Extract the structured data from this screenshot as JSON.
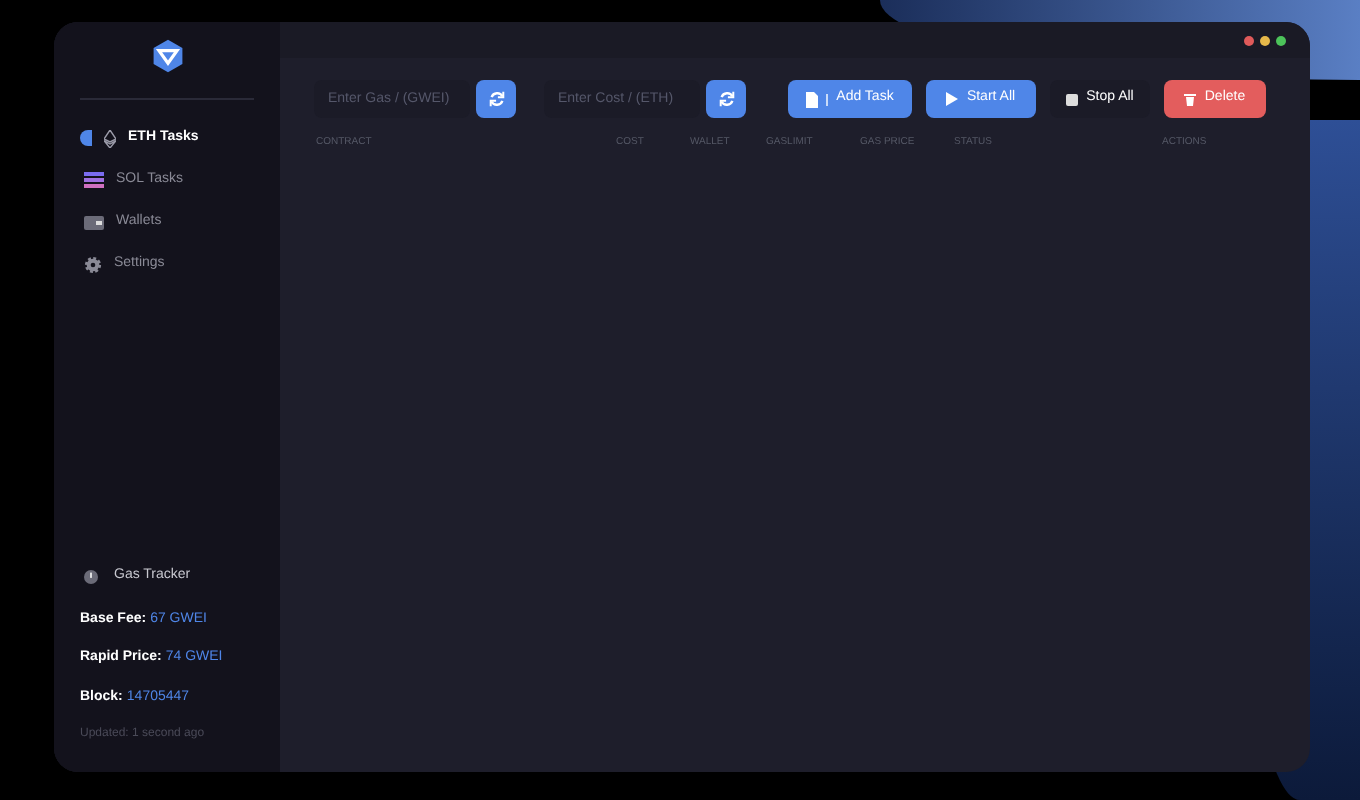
{
  "sidebar": {
    "items": [
      {
        "label": "ETH Tasks",
        "selected": true,
        "kind": "eth"
      },
      {
        "label": "SOL Tasks",
        "selected": false,
        "kind": "sol"
      },
      {
        "label": "Wallets",
        "selected": false,
        "kind": "wallet"
      },
      {
        "label": "Settings",
        "selected": false,
        "kind": "settings"
      }
    ]
  },
  "gas_tracker": {
    "title": "Gas Tracker",
    "rows": [
      {
        "label": "Base Fee:",
        "value": "67 GWEI"
      },
      {
        "label": "Rapid Price:",
        "value": "74 GWEI"
      },
      {
        "label": "Block:",
        "value": "14705447"
      }
    ],
    "updated": "Updated: 1 second ago"
  },
  "toolbar": {
    "gas_field": {
      "placeholder": "Enter Gas / (GWEI)"
    },
    "cost_field": {
      "placeholder": "Enter Cost / (ETH)"
    },
    "buttons": [
      {
        "label": "Add Task",
        "kind": "add"
      },
      {
        "label": "Start All",
        "kind": "start"
      },
      {
        "label": "Stop All",
        "kind": "stop"
      },
      {
        "label": "Delete",
        "kind": "delete"
      }
    ]
  },
  "table": {
    "columns": [
      "CONTRACT",
      "COST",
      "WALLET",
      "GASLIMIT",
      "GAS PRICE",
      "STATUS",
      "ACTIONS"
    ]
  }
}
